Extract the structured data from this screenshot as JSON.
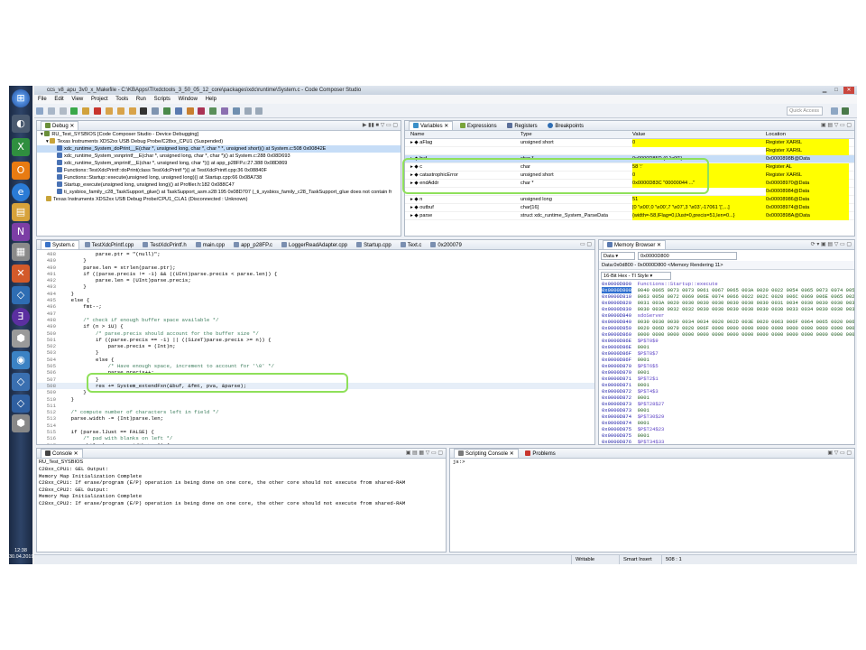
{
  "window": {
    "title": "ccs_v8_apu_3v0_x_Makefile - C:\\KBApps\\TI\\xdctools_3_50_05_12_core\\packages\\xdc\\runtime\\System.c - Code Composer Studio",
    "menu": [
      "File",
      "Edit",
      "View",
      "Project",
      "Tools",
      "Run",
      "Scripts",
      "Window",
      "Help"
    ],
    "quick_access": "Quick Access"
  },
  "taskbar": {
    "time": "12:38",
    "date": "30.04.2019"
  },
  "debug": {
    "tab": "Debug",
    "items": [
      "RU_Test_SYSBIOS [Code Composer Studio - Device Debugging]",
      "Texas Instruments XDS2xx USB Debug Probe/C28xx_CPU1 (Suspended)",
      "xdc_runtime_System_doPrint__E(char *, unsigned long, char *, char * *, unsigned short)() at System.c:508 0x00842E",
      "xdc_runtime_System_vsnprintf__E(char *, unsigned long, char *, char *)() at System.c:288 0x08D693",
      "xdc_runtime_System_snprintf__E(char *, unsigned long, char *)() at app_p28FP.c:27.388 0x08D869",
      "Functions::TestXdcPrintf::doPrint(class TestXdcPrintf *)() at TestXdcPrintf.cpp:36 0x08840F",
      "Functions::Startup::execute(unsigned long, unsigned long)() at Startup.cpp:66 0x08A738",
      "Startup_execute(unsigned long, unsigned long)() at Profiler.h:182 0x088C47",
      "ti_sysbios_family_c28_TaskSupport_glue() at TaskSupport_asm.s28:195 0x08D707  (_ti_sysbios_family_c28_TaskSupport_glue does not contain fr",
      "Texas Instruments XDS2xx USB Debug Probe/CPU1_CLA1 (Disconnected : Unknown)"
    ]
  },
  "variables": {
    "tabs": [
      "Variables",
      "Expressions",
      "Registers",
      "Breakpoints"
    ],
    "headers": [
      "Name",
      "Type",
      "Value",
      "Location"
    ],
    "rows": [
      {
        "name": "aFlag",
        "type": "unsigned short",
        "value": "0",
        "loc": "Register XAR6L"
      },
      {
        "name": "",
        "type": "",
        "value": "",
        "loc": "Register XAR6L"
      },
      {
        "name": "buf",
        "type": "char *",
        "value": "0x0000D85D (0 '\\x00')",
        "loc": "0x0000898B@Data"
      },
      {
        "name": "c",
        "type": "char",
        "value": "58 ':'",
        "loc": "Register AL"
      },
      {
        "name": "catastrophicError",
        "type": "unsigned short",
        "value": "0",
        "loc": "Register XAR6L"
      },
      {
        "name": "endAddr",
        "type": "char *",
        "value": "0x0000D83C \"00000044 ...\"",
        "loc": "0x00008970@Data"
      },
      {
        "name": "",
        "type": "",
        "value": "",
        "loc": "0x00008984@Data"
      },
      {
        "name": "n",
        "type": "unsigned long",
        "value": "51",
        "loc": "0x00008986@Data"
      },
      {
        "name": "outbuf",
        "type": "char[16]",
        "value": "[0 '\\x00',0 '\\x00',7 '\\x07',3 '\\x03',-17061 '[',...]",
        "loc": "0x00008974@Data"
      },
      {
        "name": "parse",
        "type": "struct xdc_runtime_System_ParseData",
        "value": "{width=-58,lFlag=0,lJust=0,precis=51,len=0...}",
        "loc": "0x0000898A@Data"
      }
    ]
  },
  "editor": {
    "tabs": [
      "System.c",
      "TestXdcPrintf.cpp",
      "TestXdcPrintf.h",
      "main.cpp",
      "app_p28FP.c",
      "LoggerReadAdapter.cpp",
      "Startup.cpp",
      "Text.c",
      "0x200079"
    ],
    "lines": [
      {
        "n": "488",
        "t": "            parse.ptr = \"(null)\";"
      },
      {
        "n": "489",
        "t": "        }"
      },
      {
        "n": "490",
        "t": "        parse.len = strlen(parse.ptr);"
      },
      {
        "n": "491",
        "t": "        if ((parse.precis != -1) && ((UInt)parse.precis < parse.len)) {"
      },
      {
        "n": "492",
        "t": "            parse.len = (UInt)parse.precis;"
      },
      {
        "n": "493",
        "t": "        }"
      },
      {
        "n": "494",
        "t": "    }"
      },
      {
        "n": "495",
        "t": "    else {"
      },
      {
        "n": "496",
        "t": "        fmt--;"
      },
      {
        "n": "497",
        "t": ""
      },
      {
        "n": "498",
        "t": "        /* check if enough buffer space available */"
      },
      {
        "n": "499",
        "t": "        if (n > 1U) {"
      },
      {
        "n": "500",
        "t": "            /* parse.precis should account for the buffer size */"
      },
      {
        "n": "501",
        "t": "            if ((parse.precis == -1) || ((SizeT)parse.precis >= n)) {"
      },
      {
        "n": "502",
        "t": "                parse.precis = (Int)n;"
      },
      {
        "n": "503",
        "t": "            }"
      },
      {
        "n": "504",
        "t": "            else {"
      },
      {
        "n": "505",
        "t": "                /* Have enough space, increment to account for '\\0' */"
      },
      {
        "n": "506",
        "t": "                parse.precis++;"
      },
      {
        "n": "507",
        "t": "            }"
      },
      {
        "n": "508",
        "t": "            res += System_extendFxn(&buf, &fmt, pva, &parse);"
      },
      {
        "n": "509",
        "t": "        }"
      },
      {
        "n": "510",
        "t": "    }"
      },
      {
        "n": "511",
        "t": ""
      },
      {
        "n": "512",
        "t": "    /* compute number of characters left in field */"
      },
      {
        "n": "513",
        "t": "    parse.width -= (Int)parse.len;"
      },
      {
        "n": "514",
        "t": ""
      },
      {
        "n": "515",
        "t": "    if (parse.lJust == FALSE) {"
      },
      {
        "n": "516",
        "t": "        /* pad with blanks on left */"
      },
      {
        "n": "517",
        "t": "        while (--parse.width >= 0) {"
      }
    ]
  },
  "memory": {
    "tab": "Memory Browser",
    "space": "Data",
    "address": "0x0000D800",
    "rendering_tab": "Data:0x0d800 - 0x0000D800 <Memory Rendering 11>",
    "format": "16-Bit Hex - TI Style",
    "lines": [
      {
        "a": "0x0000D800",
        "d": "Functions::Startup::execute",
        "kind": "lbl"
      },
      {
        "a": "0x0000D800",
        "d": "0040 0065 0073 0073 0061 0067 0065 003A 0020 0022 0054 0065 0073 0074 0058 0064",
        "kind": "dat"
      },
      {
        "a": "0x0000D810",
        "d": "0063 0050 0072 0069 006E 0074 0066 0022 002C 0020 006C 0069 006E 0065 0020 0034",
        "kind": "dat"
      },
      {
        "a": "0x0000D820",
        "d": "0031 003A 0020 0030 0030 0030 0030 0030 0030 0031 0034 0030 0030 0030 0030 0030",
        "kind": "dat"
      },
      {
        "a": "0x0000D830",
        "d": "0030 0030 0032 0032 0030 0030 0030 0030 0030 0030 0033 0034 0030 0030 0030 0030",
        "kind": "dat"
      },
      {
        "a": "0x0000D840",
        "d": "sdoServer",
        "kind": "lbl"
      },
      {
        "a": "0x0000D840",
        "d": "0030 0030 0030 0034 0034 0020 002D 003E 0020 0063 006F 0064 0065 0020 006F 0066",
        "kind": "dat"
      },
      {
        "a": "0x0000D850",
        "d": "0020 006D 0079 0020 006F 0000 0000 0000 0000 0000 0000 0000 0000 0000 0000 0000",
        "kind": "dat"
      },
      {
        "a": "0x0000D860",
        "d": "0000 0000 0000 0000 0000 0000 0000 0000 0000 0000 0000 0000 0000 0000 0000 0000",
        "kind": "dat"
      },
      {
        "a": "0x0000D86E",
        "d": "$P$T0$9",
        "kind": "lbl"
      },
      {
        "a": "0x0000D86E",
        "d": "0001",
        "kind": "dat"
      },
      {
        "a": "0x0000D86F",
        "d": "$P$T8$7",
        "kind": "lbl"
      },
      {
        "a": "0x0000D86F",
        "d": "0001",
        "kind": "dat"
      },
      {
        "a": "0x0000D870",
        "d": "$P$T6$5",
        "kind": "lbl"
      },
      {
        "a": "0x0000D870",
        "d": "0001",
        "kind": "dat"
      },
      {
        "a": "0x0000D871",
        "d": "$P$T2$1",
        "kind": "lbl"
      },
      {
        "a": "0x0000D871",
        "d": "0001",
        "kind": "dat"
      },
      {
        "a": "0x0000D872",
        "d": "$P$T4$3",
        "kind": "lbl"
      },
      {
        "a": "0x0000D872",
        "d": "0001",
        "kind": "dat"
      },
      {
        "a": "0x0000D873",
        "d": "$P$T28$27",
        "kind": "lbl"
      },
      {
        "a": "0x0000D873",
        "d": "0001",
        "kind": "dat"
      },
      {
        "a": "0x0000D874",
        "d": "$P$T30$29",
        "kind": "lbl"
      },
      {
        "a": "0x0000D874",
        "d": "0001",
        "kind": "dat"
      },
      {
        "a": "0x0000D875",
        "d": "$P$T24$23",
        "kind": "lbl"
      },
      {
        "a": "0x0000D875",
        "d": "0001",
        "kind": "dat"
      },
      {
        "a": "0x0000D876",
        "d": "$P$T34$33",
        "kind": "lbl"
      }
    ]
  },
  "console": {
    "tab": "Console",
    "session": "RU_Test_SYSBIOS",
    "lines": [
      "C28xx_CPU1: GEL Output:",
      "Memory Map Initialization Complete",
      "C28xx_CPU1: If erase/program (E/P) operation is being done on one core, the other core should not execute from shared-RAM",
      "C28xx_CPU2: GEL Output:",
      "Memory Map Initialization Complete",
      "C28xx_CPU2: If erase/program (E/P) operation is being done on one core, the other core should not execute from shared-RAM"
    ]
  },
  "scripting": {
    "tabs": [
      "Scripting Console",
      "Problems"
    ],
    "prompt": "js:>"
  },
  "status": {
    "writable": "Writable",
    "insert": "Smart Insert",
    "position": "508 : 1"
  }
}
